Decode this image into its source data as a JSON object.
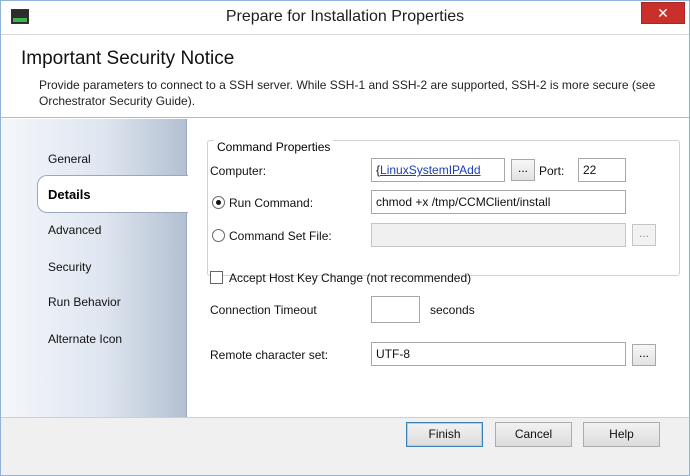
{
  "window": {
    "title": "Prepare for Installation Properties",
    "close_glyph": "✕"
  },
  "header": {
    "title": "Important Security Notice",
    "description": "Provide parameters to connect to a SSH server. While SSH-1 and SSH-2 are supported, SSH-2 is more secure (see Orchestrator Security Guide)."
  },
  "sidebar": {
    "items": [
      {
        "label": "General"
      },
      {
        "label": "Details",
        "selected": true
      },
      {
        "label": "Advanced"
      },
      {
        "label": "Security"
      },
      {
        "label": "Run Behavior"
      },
      {
        "label": "Alternate Icon"
      }
    ]
  },
  "command_properties": {
    "legend": "Command Properties",
    "computer": {
      "label": "Computer:",
      "prefix": "{",
      "value": "LinuxSystemIPAdd",
      "browse": "..."
    },
    "port": {
      "label": "Port:",
      "value": "22"
    },
    "run_command": {
      "label": "Run Command:",
      "value": "chmod +x /tmp/CCMClient/install",
      "checked": true
    },
    "command_set_file": {
      "label": "Command Set File:",
      "value": "",
      "browse": "...",
      "checked": false
    }
  },
  "accept_host_key": {
    "label": "Accept Host Key Change (not recommended)",
    "checked": false
  },
  "connection_timeout": {
    "label": "Connection Timeout",
    "value": "",
    "unit": "seconds"
  },
  "remote_charset": {
    "label": "Remote character set:",
    "value": "UTF-8",
    "browse": "..."
  },
  "footer": {
    "finish": "Finish",
    "cancel": "Cancel",
    "help": "Help"
  },
  "icons": {
    "app": "runbook-app-icon",
    "close": "close-icon"
  },
  "colors": {
    "sidebar_gradient_end": "#b3c0d2",
    "link": "#1a3fb0",
    "close": "#c9302c",
    "status_bar": "#3fb34f"
  }
}
